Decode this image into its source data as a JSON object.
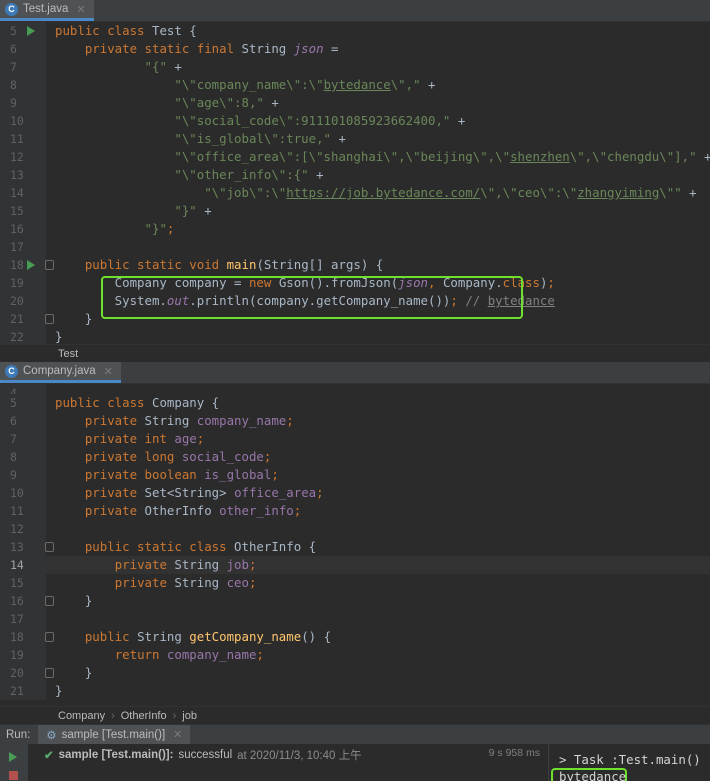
{
  "editor1": {
    "tab_name": "Test.java",
    "tab_icon": "class-icon",
    "lines": [
      {
        "n": "5",
        "run": true,
        "fold": false,
        "current": false,
        "tokens": [
          [
            "kw",
            "public class "
          ],
          [
            "",
            "Test {"
          ]
        ]
      },
      {
        "n": "6",
        "run": false,
        "fold": false,
        "current": false,
        "tokens": [
          [
            "",
            "    "
          ],
          [
            "kw",
            "private static final "
          ],
          [
            "",
            "String "
          ],
          [
            "fi",
            "json"
          ],
          [
            "",
            " ="
          ]
        ]
      },
      {
        "n": "7",
        "run": false,
        "fold": false,
        "current": false,
        "tokens": [
          [
            "",
            "            "
          ],
          [
            "str",
            "\"{\" "
          ],
          [
            "",
            "+"
          ]
        ]
      },
      {
        "n": "8",
        "run": false,
        "fold": false,
        "current": false,
        "tokens": [
          [
            "",
            "                "
          ],
          [
            "str",
            "\"\\\"company_name\\\":\\\""
          ],
          [
            "str ul",
            "bytedance"
          ],
          [
            "str",
            "\\\",\" "
          ],
          [
            "",
            "+"
          ]
        ]
      },
      {
        "n": "9",
        "run": false,
        "fold": false,
        "current": false,
        "tokens": [
          [
            "",
            "                "
          ],
          [
            "str",
            "\"\\\"age\\\":8,\" "
          ],
          [
            "",
            "+"
          ]
        ]
      },
      {
        "n": "10",
        "run": false,
        "fold": false,
        "current": false,
        "tokens": [
          [
            "",
            "                "
          ],
          [
            "str",
            "\"\\\"social_code\\\":911101085923662400,\" "
          ],
          [
            "",
            "+"
          ]
        ]
      },
      {
        "n": "11",
        "run": false,
        "fold": false,
        "current": false,
        "tokens": [
          [
            "",
            "                "
          ],
          [
            "str",
            "\"\\\"is_global\\\":true,\" "
          ],
          [
            "",
            "+"
          ]
        ]
      },
      {
        "n": "12",
        "run": false,
        "fold": false,
        "current": false,
        "tokens": [
          [
            "",
            "                "
          ],
          [
            "str",
            "\"\\\"office_area\\\":[\\\"shanghai\\\",\\\"beijing\\\",\\\""
          ],
          [
            "str ul",
            "shenzhen"
          ],
          [
            "str",
            "\\\",\\\"chengdu\\\"],\" "
          ],
          [
            "",
            "+"
          ]
        ]
      },
      {
        "n": "13",
        "run": false,
        "fold": false,
        "current": false,
        "tokens": [
          [
            "",
            "                "
          ],
          [
            "str",
            "\"\\\"other_info\\\":{\" "
          ],
          [
            "",
            "+"
          ]
        ]
      },
      {
        "n": "14",
        "run": false,
        "fold": false,
        "current": false,
        "tokens": [
          [
            "",
            "                    "
          ],
          [
            "str",
            "\"\\\"job\\\":\\\""
          ],
          [
            "str ul",
            "https://job.bytedance.com/"
          ],
          [
            "str",
            "\\\",\\\"ceo\\\":\\\""
          ],
          [
            "str ul",
            "zhangyiming"
          ],
          [
            "str",
            "\\\"\" "
          ],
          [
            "",
            "+"
          ]
        ]
      },
      {
        "n": "15",
        "run": false,
        "fold": false,
        "current": false,
        "tokens": [
          [
            "",
            "                "
          ],
          [
            "str",
            "\"}\" "
          ],
          [
            "",
            "+"
          ]
        ]
      },
      {
        "n": "16",
        "run": false,
        "fold": false,
        "current": false,
        "tokens": [
          [
            "",
            "            "
          ],
          [
            "str",
            "\"}\""
          ],
          [
            "kw",
            ";"
          ]
        ]
      },
      {
        "n": "17",
        "run": false,
        "fold": false,
        "current": false,
        "tokens": []
      },
      {
        "n": "18",
        "run": true,
        "fold": true,
        "current": false,
        "tokens": [
          [
            "",
            "    "
          ],
          [
            "kw",
            "public static void "
          ],
          [
            "fn",
            "main"
          ],
          [
            "",
            "(String[] args) {"
          ]
        ]
      },
      {
        "n": "19",
        "run": false,
        "fold": false,
        "current": false,
        "tokens": [
          [
            "",
            "        Company company = "
          ],
          [
            "kw",
            "new "
          ],
          [
            "",
            "Gson().fromJson("
          ],
          [
            "fi",
            "json"
          ],
          [
            "kw",
            ", "
          ],
          [
            "",
            "Company."
          ],
          [
            "kw",
            "class"
          ],
          [
            "",
            ")"
          ],
          [
            "kw",
            ";"
          ]
        ]
      },
      {
        "n": "20",
        "run": false,
        "fold": false,
        "current": false,
        "tokens": [
          [
            "",
            "        System."
          ],
          [
            "fi",
            "out"
          ],
          [
            "",
            ".println(company.getCompany_name())"
          ],
          [
            "kw",
            "; "
          ],
          [
            "cmt",
            "// "
          ],
          [
            "cmt ul",
            "bytedance"
          ]
        ]
      },
      {
        "n": "21",
        "run": false,
        "fold": true,
        "current": false,
        "tokens": [
          [
            "",
            "    }"
          ]
        ]
      },
      {
        "n": "22",
        "run": false,
        "fold": false,
        "current": false,
        "tokens": [
          [
            "",
            "}"
          ]
        ]
      }
    ],
    "breadcrumb": [
      "Test"
    ]
  },
  "editor2": {
    "tab_name": "Company.java",
    "tab_icon": "class-icon",
    "lines": [
      {
        "n": "4",
        "run": false,
        "fold": false,
        "current": false,
        "tokens": []
      },
      {
        "n": "5",
        "run": false,
        "fold": false,
        "current": false,
        "tokens": [
          [
            "kw",
            "public class "
          ],
          [
            "",
            "Company {"
          ]
        ]
      },
      {
        "n": "6",
        "run": false,
        "fold": false,
        "current": false,
        "tokens": [
          [
            "",
            "    "
          ],
          [
            "kw",
            "private "
          ],
          [
            "",
            "String "
          ],
          [
            "fld",
            "company_name"
          ],
          [
            "kw",
            ";"
          ]
        ]
      },
      {
        "n": "7",
        "run": false,
        "fold": false,
        "current": false,
        "tokens": [
          [
            "",
            "    "
          ],
          [
            "kw",
            "private int "
          ],
          [
            "fld",
            "age"
          ],
          [
            "kw",
            ";"
          ]
        ]
      },
      {
        "n": "8",
        "run": false,
        "fold": false,
        "current": false,
        "tokens": [
          [
            "",
            "    "
          ],
          [
            "kw",
            "private long "
          ],
          [
            "fld",
            "social_code"
          ],
          [
            "kw",
            ";"
          ]
        ]
      },
      {
        "n": "9",
        "run": false,
        "fold": false,
        "current": false,
        "tokens": [
          [
            "",
            "    "
          ],
          [
            "kw",
            "private boolean "
          ],
          [
            "fld",
            "is_global"
          ],
          [
            "kw",
            ";"
          ]
        ]
      },
      {
        "n": "10",
        "run": false,
        "fold": false,
        "current": false,
        "tokens": [
          [
            "",
            "    "
          ],
          [
            "kw",
            "private "
          ],
          [
            "",
            "Set<String> "
          ],
          [
            "fld",
            "office_area"
          ],
          [
            "kw",
            ";"
          ]
        ]
      },
      {
        "n": "11",
        "run": false,
        "fold": false,
        "current": false,
        "tokens": [
          [
            "",
            "    "
          ],
          [
            "kw",
            "private "
          ],
          [
            "",
            "OtherInfo "
          ],
          [
            "fld",
            "other_info"
          ],
          [
            "kw",
            ";"
          ]
        ]
      },
      {
        "n": "12",
        "run": false,
        "fold": false,
        "current": false,
        "tokens": []
      },
      {
        "n": "13",
        "run": false,
        "fold": true,
        "current": false,
        "tokens": [
          [
            "",
            "    "
          ],
          [
            "kw",
            "public static class "
          ],
          [
            "",
            "OtherInfo {"
          ]
        ]
      },
      {
        "n": "14",
        "run": false,
        "fold": false,
        "current": true,
        "tokens": [
          [
            "",
            "        "
          ],
          [
            "kw",
            "private "
          ],
          [
            "",
            "String "
          ],
          [
            "fld",
            "job"
          ],
          [
            "kw",
            ";"
          ]
        ]
      },
      {
        "n": "15",
        "run": false,
        "fold": false,
        "current": false,
        "tokens": [
          [
            "",
            "        "
          ],
          [
            "kw",
            "private "
          ],
          [
            "",
            "String "
          ],
          [
            "fld",
            "ceo"
          ],
          [
            "kw",
            ";"
          ]
        ]
      },
      {
        "n": "16",
        "run": false,
        "fold": true,
        "current": false,
        "tokens": [
          [
            "",
            "    }"
          ]
        ]
      },
      {
        "n": "17",
        "run": false,
        "fold": false,
        "current": false,
        "tokens": []
      },
      {
        "n": "18",
        "run": false,
        "fold": true,
        "current": false,
        "tokens": [
          [
            "",
            "    "
          ],
          [
            "kw",
            "public "
          ],
          [
            "",
            "String "
          ],
          [
            "fn",
            "getCompany_name"
          ],
          [
            "",
            "() {"
          ]
        ]
      },
      {
        "n": "19",
        "run": false,
        "fold": false,
        "current": false,
        "tokens": [
          [
            "",
            "        "
          ],
          [
            "kw",
            "return "
          ],
          [
            "fld",
            "company_name"
          ],
          [
            "kw",
            ";"
          ]
        ]
      },
      {
        "n": "20",
        "run": false,
        "fold": true,
        "current": false,
        "tokens": [
          [
            "",
            "    }"
          ]
        ]
      },
      {
        "n": "21",
        "run": false,
        "fold": false,
        "current": false,
        "tokens": [
          [
            "",
            "}"
          ]
        ]
      }
    ],
    "breadcrumb": [
      "Company",
      "OtherInfo",
      "job"
    ]
  },
  "run_panel": {
    "label": "Run:",
    "tab_name": "sample [Test.main()]",
    "result_name": "sample [Test.main()]:",
    "result_status": "successful",
    "result_time": "at 2020/11/3, 10:40 上午",
    "duration": "9 s 958 ms",
    "console_lines": [
      "> Task :Test.main()",
      "bytedance"
    ]
  },
  "colors": {
    "highlight_box": "#6ee02e",
    "accent": "#4a88c7"
  }
}
